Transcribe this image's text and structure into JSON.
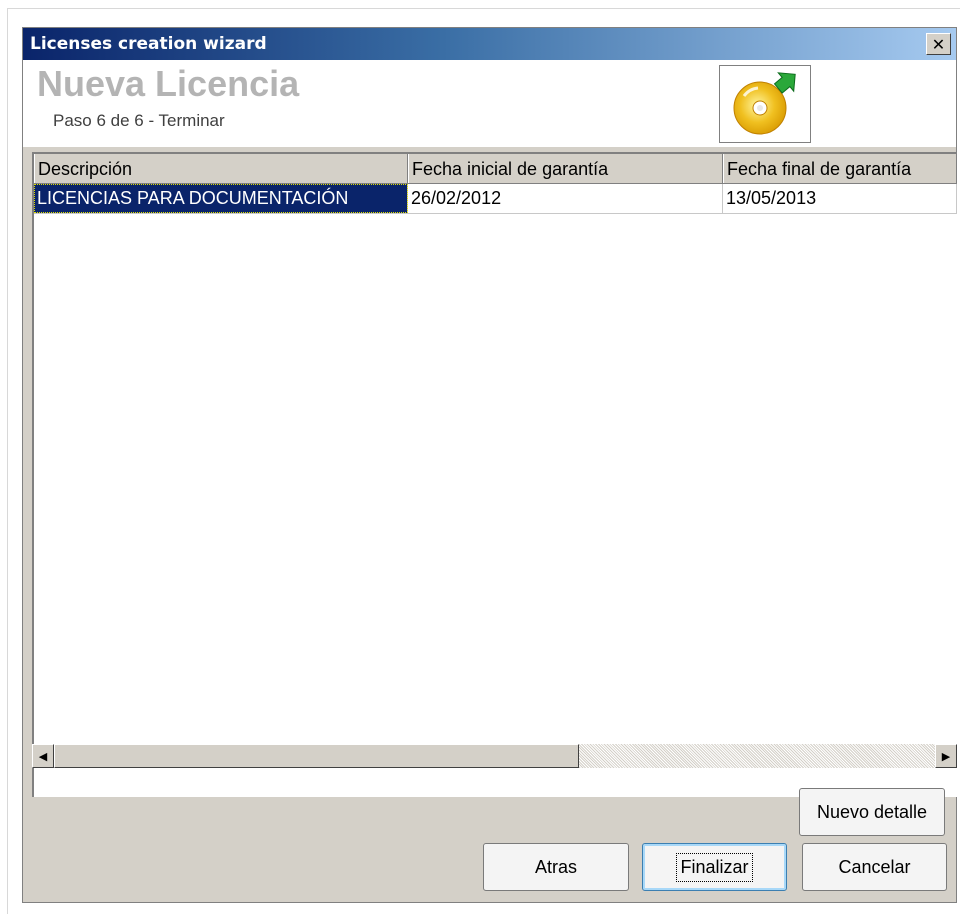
{
  "window": {
    "title": "Licenses creation wizard",
    "close_glyph": "✕"
  },
  "header": {
    "title": "Nueva Licencia",
    "step": "Paso 6 de 6 - Terminar",
    "icon": "cd-add-icon"
  },
  "grid": {
    "columns": [
      {
        "label": "Descripción"
      },
      {
        "label": "Fecha inicial de garantía"
      },
      {
        "label": "Fecha final de garantía"
      }
    ],
    "rows": [
      {
        "description": "LICENCIAS PARA DOCUMENTACIÓN",
        "start_date": "26/02/2012",
        "end_date": "13/05/2013",
        "selected": true
      }
    ]
  },
  "scrollbar": {
    "left_arrow": "◀",
    "right_arrow": "▶"
  },
  "buttons": {
    "new_detail": "Nuevo detalle",
    "back": "Atras",
    "finish": "Finalizar",
    "cancel": "Cancelar"
  },
  "colors": {
    "title_gradient_start": "#0a246a",
    "title_gradient_end": "#a6caf0",
    "selection": "#0a246a",
    "window_face": "#d4d0c8"
  }
}
